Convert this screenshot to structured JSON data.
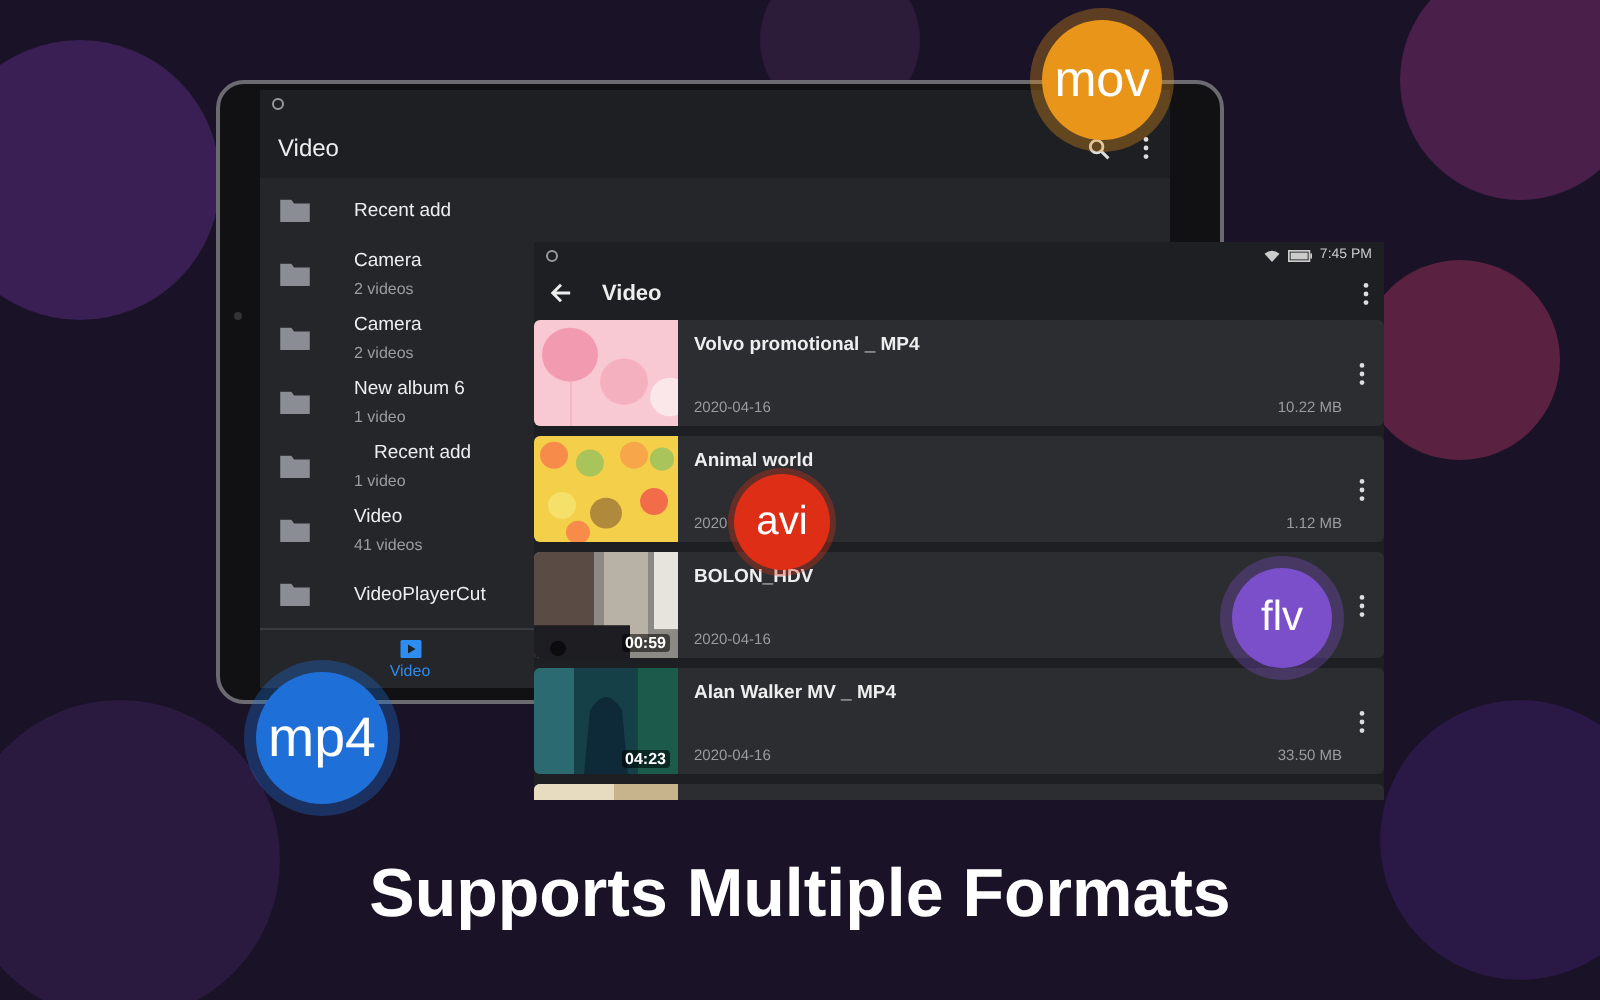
{
  "back_screen": {
    "title": "Video",
    "folders": [
      {
        "name": "Recent add",
        "indented": false
      },
      {
        "name": "Camera",
        "count": "2 videos",
        "indented": false
      },
      {
        "name": "Camera",
        "count": "2 videos",
        "indented": false
      },
      {
        "name": "New album 6",
        "count": "1 video",
        "indented": false
      },
      {
        "name": "Recent add",
        "count": "1 video",
        "indented": true
      },
      {
        "name": "Video",
        "count": "41 videos",
        "indented": false
      },
      {
        "name": "VideoPlayerCut",
        "indented": false
      }
    ],
    "nav": [
      {
        "label": "Video",
        "selected": true
      }
    ]
  },
  "front_screen": {
    "time": "7:45 PM",
    "title": "Video",
    "videos": [
      {
        "kind": "video",
        "title": "Volvo promotional _ MP4",
        "date": "2020-04-16",
        "size": "10.22 MB"
      },
      {
        "kind": "video",
        "title": "Animal world",
        "date": "2020",
        "size": "1.12 MB"
      },
      {
        "kind": "video",
        "title": "BOLON_HDV",
        "date": "2020-04-16",
        "duration": "00:59"
      },
      {
        "kind": "video",
        "title": "Alan Walker MV _ MP4",
        "date": "2020-04-16",
        "size": "33.50 MB",
        "duration": "04:23"
      },
      {
        "kind": "picture"
      }
    ]
  },
  "badges": [
    {
      "label": "mov",
      "color": "#e8951a"
    },
    {
      "label": "avi",
      "color": "#de2f16"
    },
    {
      "label": "flv",
      "color": "#7b4fc9"
    },
    {
      "label": "mp4",
      "color": "#1f6fd8"
    }
  ],
  "headline": "Supports Multiple Formats"
}
